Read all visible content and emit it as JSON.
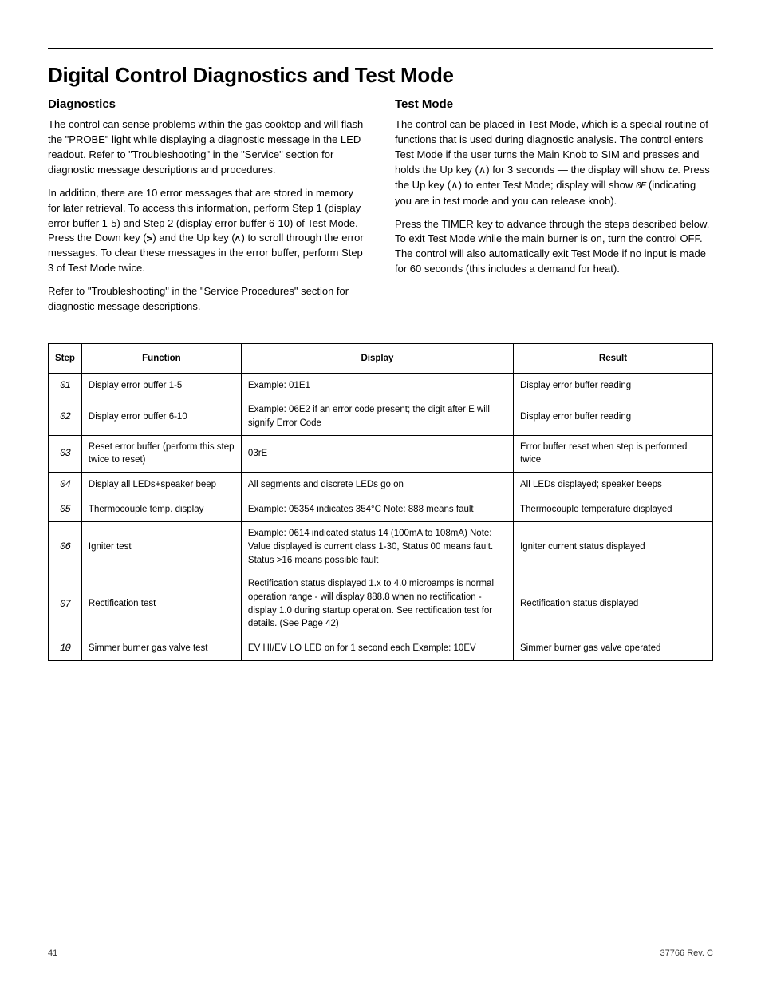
{
  "page": {
    "title": "Digital Control Diagnostics and Test Mode",
    "diagnostics": {
      "heading": "Diagnostics",
      "p1": "The control can sense problems within the gas cooktop and will flash the \"PROBE\" light while displaying a diagnostic message in the LED readout. Refer to \"Troubleshooting\" in the \"Service\" section for diagnostic message descriptions and procedures.",
      "p2a": "In addition, there are 10 error messages that are stored in memory for later retrieval. To access this information, perform Step 1 (display error buffer 1-5) and Step 2 (display error buffer 6-10) of Test Mode. Press the Down key (",
      "p2b": ") and the Up key (",
      "p2c": ") to scroll through the error messages. To clear these messages in the error buffer, perform Step 3 of Test Mode twice.",
      "p3": "Refer to \"Troubleshooting\" in the \"Service Procedures\" section for diagnostic message descriptions."
    },
    "testmode": {
      "heading": "Test Mode",
      "p1": "The control can be placed in Test Mode, which is a special routine of functions that is used during diagnostic analysis. The control enters Test Mode if the user turns the Main Knob to SIM and presses and holds the Up key (∧) for 3 seconds — the display will show ",
      "p1x": "te",
      "p1y": ". Press the Up key (∧) to enter Test Mode; display will show ",
      "p1z": "0E",
      "p1end": " (indicating you are in test mode and you can release knob).",
      "p2": "Press the TIMER key to advance through the steps described below. To exit Test Mode while the main burner is on, turn the control OFF. The control will also automatically exit Test Mode if no input is made for 60 seconds (this includes a demand for heat)."
    },
    "table": {
      "headers": [
        "Step",
        "Function",
        "Display",
        "Result"
      ],
      "rows": [
        {
          "step": "01",
          "func": "Display error buffer 1-5",
          "display": "Example: 01E1",
          "result": "Display error buffer reading"
        },
        {
          "step": "02",
          "func": "Display error buffer 6-10",
          "display": "Example: 06E2 if an error code present; the digit after E will signify Error Code",
          "result": "Display error buffer reading"
        },
        {
          "step": "03",
          "func": "Reset error buffer (perform this step twice to reset)",
          "display": "03rE",
          "result": "Error buffer reset when step is performed twice"
        },
        {
          "step": "04",
          "func": "Display all LEDs+speaker beep",
          "display": "All segments and discrete LEDs go on",
          "result": "All LEDs displayed; speaker beeps"
        },
        {
          "step": "05",
          "func": "Thermocouple temp. display",
          "display": "Example: 05354 indicates 354°C Note: 888 means fault",
          "result": "Thermocouple temperature displayed"
        },
        {
          "step": "06",
          "func": "Igniter test",
          "display": "Example: 0614 indicated status 14 (100mA to 108mA) Note: Value displayed is current class 1-30, Status 00 means fault. Status >16 means possible fault",
          "result": "Igniter current status displayed"
        },
        {
          "step": "07",
          "func": "Rectification test",
          "display": "Rectification status displayed 1.x to 4.0 microamps is normal operation range - will display 888.8 when no rectification - display 1.0 during startup operation. See rectification test for details. (See Page 42)",
          "result": "Rectification status displayed"
        },
        {
          "step": "10",
          "func": "Simmer burner gas valve test",
          "display": "EV HI/EV LO LED on for 1 second each Example: 10EV",
          "result": "Simmer burner gas valve operated"
        }
      ]
    }
  },
  "footer": {
    "left": "41",
    "right": "37766 Rev. C"
  }
}
